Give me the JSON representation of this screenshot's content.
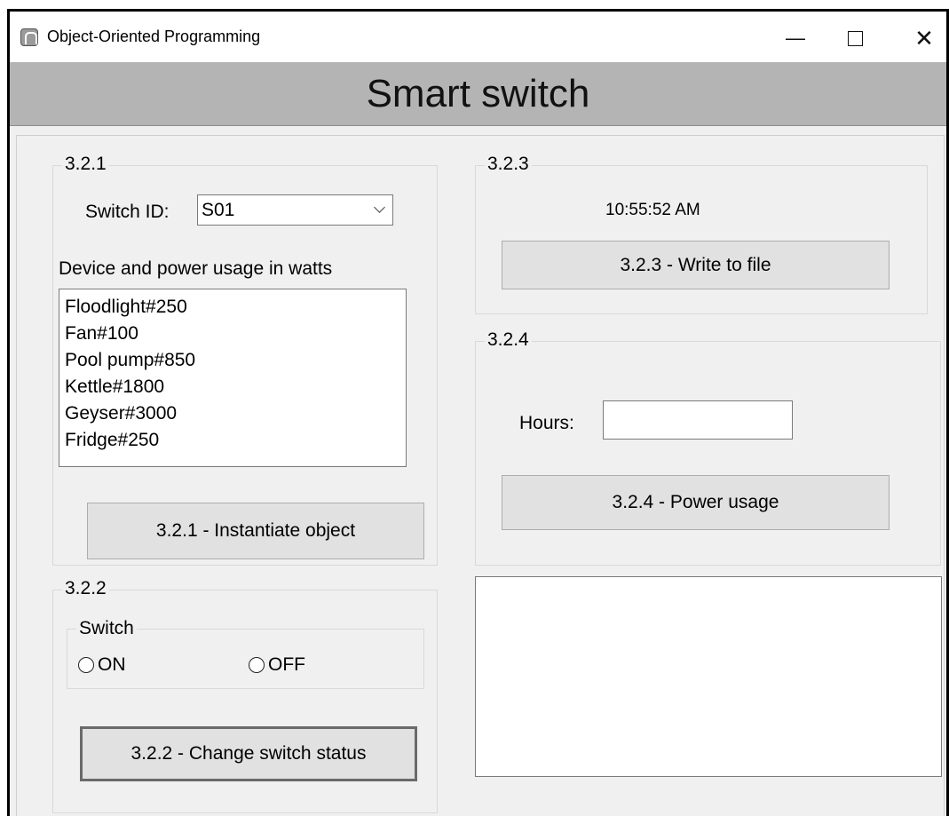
{
  "window": {
    "title": "Object-Oriented Programming",
    "icon": "app-icon",
    "controls": {
      "minimize": "—",
      "close": "✕"
    }
  },
  "header": {
    "title": "Smart switch"
  },
  "group_321": {
    "label": "3.2.1",
    "switch_id_label": "Switch ID:",
    "switch_id_value": "S01",
    "devices_label": "Device and power usage in watts",
    "devices": [
      "Floodlight#250",
      "Fan#100",
      "Pool pump#850",
      "Kettle#1800",
      "Geyser#3000",
      "Fridge#250"
    ],
    "button": "3.2.1 -  Instantiate object"
  },
  "group_322": {
    "label": "3.2.2",
    "switch_group_label": "Switch",
    "radio_on": "ON",
    "radio_off": "OFF",
    "button": "3.2.2 - Change switch status"
  },
  "group_323": {
    "label": "3.2.3",
    "time": "10:55:52 AM",
    "button": "3.2.3 - Write to file"
  },
  "group_324": {
    "label": "3.2.4",
    "hours_label": "Hours:",
    "hours_value": "",
    "button": "3.2.4 - Power usage"
  },
  "output": {
    "text": ""
  }
}
